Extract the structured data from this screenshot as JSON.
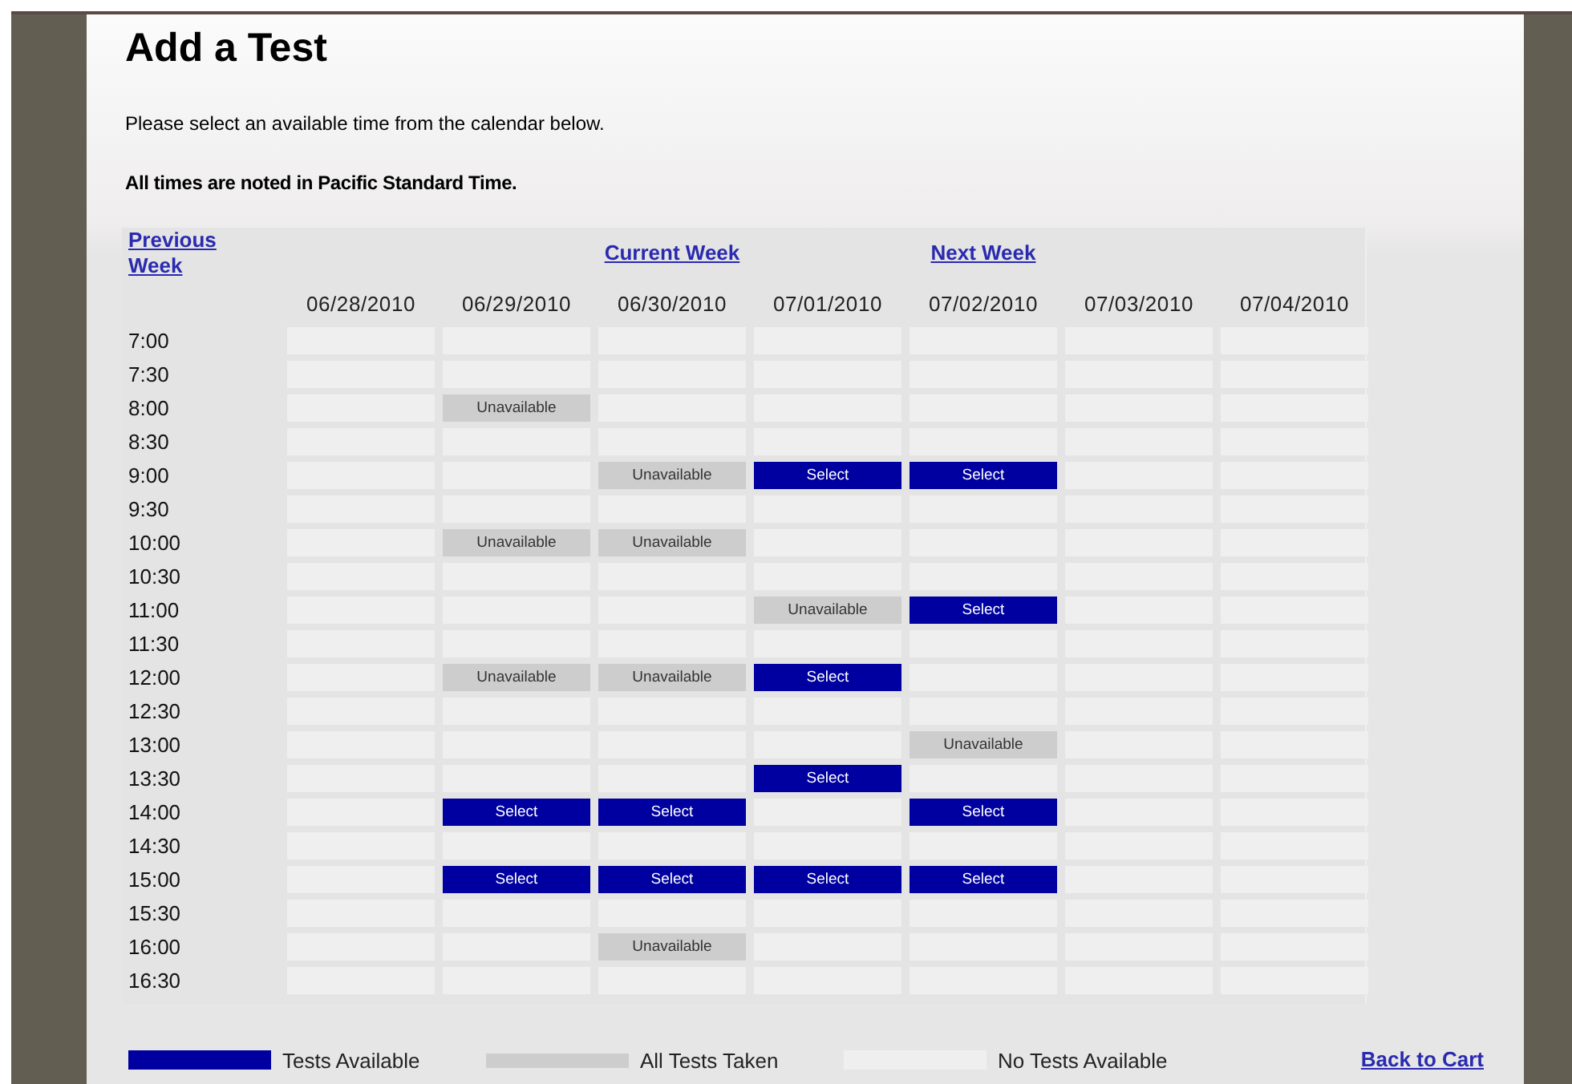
{
  "title": "Add a Test",
  "instructions": "Please select an available time from the calendar below.",
  "timezone_note": "All times are noted in Pacific Standard Time.",
  "nav": {
    "previous": "Previous Week",
    "current": "Current Week",
    "next": "Next Week"
  },
  "dates": [
    "06/28/2010",
    "06/29/2010",
    "06/30/2010",
    "07/01/2010",
    "07/02/2010",
    "07/03/2010",
    "07/04/2010"
  ],
  "rows": [
    {
      "time": "7:00",
      "cells": [
        {
          "kind": "empty"
        },
        {
          "kind": "empty"
        },
        {
          "kind": "empty"
        },
        {
          "kind": "empty"
        },
        {
          "kind": "empty"
        },
        {
          "kind": "empty"
        },
        {
          "kind": "empty"
        }
      ]
    },
    {
      "time": "7:30",
      "cells": [
        {
          "kind": "empty"
        },
        {
          "kind": "empty"
        },
        {
          "kind": "empty"
        },
        {
          "kind": "empty"
        },
        {
          "kind": "empty"
        },
        {
          "kind": "empty"
        },
        {
          "kind": "empty"
        }
      ]
    },
    {
      "time": "8:00",
      "cells": [
        {
          "kind": "empty"
        },
        {
          "kind": "unavailable",
          "label": "Unavailable"
        },
        {
          "kind": "empty"
        },
        {
          "kind": "empty"
        },
        {
          "kind": "empty"
        },
        {
          "kind": "empty"
        },
        {
          "kind": "empty"
        }
      ]
    },
    {
      "time": "8:30",
      "cells": [
        {
          "kind": "empty"
        },
        {
          "kind": "empty"
        },
        {
          "kind": "empty"
        },
        {
          "kind": "empty"
        },
        {
          "kind": "empty"
        },
        {
          "kind": "empty"
        },
        {
          "kind": "empty"
        }
      ]
    },
    {
      "time": "9:00",
      "cells": [
        {
          "kind": "empty"
        },
        {
          "kind": "empty"
        },
        {
          "kind": "unavailable",
          "label": "Unavailable"
        },
        {
          "kind": "select",
          "label": "Select"
        },
        {
          "kind": "select",
          "label": "Select"
        },
        {
          "kind": "empty"
        },
        {
          "kind": "empty"
        }
      ]
    },
    {
      "time": "9:30",
      "cells": [
        {
          "kind": "empty"
        },
        {
          "kind": "empty"
        },
        {
          "kind": "empty"
        },
        {
          "kind": "empty"
        },
        {
          "kind": "empty"
        },
        {
          "kind": "empty"
        },
        {
          "kind": "empty"
        }
      ]
    },
    {
      "time": "10:00",
      "cells": [
        {
          "kind": "empty"
        },
        {
          "kind": "unavailable",
          "label": "Unavailable"
        },
        {
          "kind": "unavailable",
          "label": "Unavailable"
        },
        {
          "kind": "empty"
        },
        {
          "kind": "empty"
        },
        {
          "kind": "empty"
        },
        {
          "kind": "empty"
        }
      ]
    },
    {
      "time": "10:30",
      "cells": [
        {
          "kind": "empty"
        },
        {
          "kind": "empty"
        },
        {
          "kind": "empty"
        },
        {
          "kind": "empty"
        },
        {
          "kind": "empty"
        },
        {
          "kind": "empty"
        },
        {
          "kind": "empty"
        }
      ]
    },
    {
      "time": "11:00",
      "cells": [
        {
          "kind": "empty"
        },
        {
          "kind": "empty"
        },
        {
          "kind": "empty"
        },
        {
          "kind": "unavailable",
          "label": "Unavailable"
        },
        {
          "kind": "select",
          "label": "Select"
        },
        {
          "kind": "empty"
        },
        {
          "kind": "empty"
        }
      ]
    },
    {
      "time": "11:30",
      "cells": [
        {
          "kind": "empty"
        },
        {
          "kind": "empty"
        },
        {
          "kind": "empty"
        },
        {
          "kind": "empty"
        },
        {
          "kind": "empty"
        },
        {
          "kind": "empty"
        },
        {
          "kind": "empty"
        }
      ]
    },
    {
      "time": "12:00",
      "cells": [
        {
          "kind": "empty"
        },
        {
          "kind": "unavailable",
          "label": "Unavailable"
        },
        {
          "kind": "unavailable",
          "label": "Unavailable"
        },
        {
          "kind": "select",
          "label": "Select"
        },
        {
          "kind": "empty"
        },
        {
          "kind": "empty"
        },
        {
          "kind": "empty"
        }
      ]
    },
    {
      "time": "12:30",
      "cells": [
        {
          "kind": "empty"
        },
        {
          "kind": "empty"
        },
        {
          "kind": "empty"
        },
        {
          "kind": "empty"
        },
        {
          "kind": "empty"
        },
        {
          "kind": "empty"
        },
        {
          "kind": "empty"
        }
      ]
    },
    {
      "time": "13:00",
      "cells": [
        {
          "kind": "empty"
        },
        {
          "kind": "empty"
        },
        {
          "kind": "empty"
        },
        {
          "kind": "empty"
        },
        {
          "kind": "unavailable",
          "label": "Unavailable"
        },
        {
          "kind": "empty"
        },
        {
          "kind": "empty"
        }
      ]
    },
    {
      "time": "13:30",
      "cells": [
        {
          "kind": "empty"
        },
        {
          "kind": "empty"
        },
        {
          "kind": "empty"
        },
        {
          "kind": "select",
          "label": "Select"
        },
        {
          "kind": "empty"
        },
        {
          "kind": "empty"
        },
        {
          "kind": "empty"
        }
      ]
    },
    {
      "time": "14:00",
      "cells": [
        {
          "kind": "empty"
        },
        {
          "kind": "select",
          "label": "Select"
        },
        {
          "kind": "select",
          "label": "Select"
        },
        {
          "kind": "empty"
        },
        {
          "kind": "select",
          "label": "Select"
        },
        {
          "kind": "empty"
        },
        {
          "kind": "empty"
        }
      ]
    },
    {
      "time": "14:30",
      "cells": [
        {
          "kind": "empty"
        },
        {
          "kind": "empty"
        },
        {
          "kind": "empty"
        },
        {
          "kind": "empty"
        },
        {
          "kind": "empty"
        },
        {
          "kind": "empty"
        },
        {
          "kind": "empty"
        }
      ]
    },
    {
      "time": "15:00",
      "cells": [
        {
          "kind": "empty"
        },
        {
          "kind": "select",
          "label": "Select"
        },
        {
          "kind": "select",
          "label": "Select"
        },
        {
          "kind": "select",
          "label": "Select"
        },
        {
          "kind": "select",
          "label": "Select"
        },
        {
          "kind": "empty"
        },
        {
          "kind": "empty"
        }
      ]
    },
    {
      "time": "15:30",
      "cells": [
        {
          "kind": "empty"
        },
        {
          "kind": "empty"
        },
        {
          "kind": "empty"
        },
        {
          "kind": "empty"
        },
        {
          "kind": "empty"
        },
        {
          "kind": "empty"
        },
        {
          "kind": "empty"
        }
      ]
    },
    {
      "time": "16:00",
      "cells": [
        {
          "kind": "empty"
        },
        {
          "kind": "empty"
        },
        {
          "kind": "unavailable",
          "label": "Unavailable"
        },
        {
          "kind": "empty"
        },
        {
          "kind": "empty"
        },
        {
          "kind": "empty"
        },
        {
          "kind": "empty"
        }
      ]
    },
    {
      "time": "16:30",
      "cells": [
        {
          "kind": "empty"
        },
        {
          "kind": "empty"
        },
        {
          "kind": "empty"
        },
        {
          "kind": "empty"
        },
        {
          "kind": "empty"
        },
        {
          "kind": "empty"
        },
        {
          "kind": "empty"
        }
      ]
    }
  ],
  "legend": [
    {
      "kind": "select",
      "label": "Tests Available"
    },
    {
      "kind": "unavailable",
      "label": "All Tests Taken"
    },
    {
      "kind": "empty",
      "label": "No Tests Available"
    }
  ],
  "back_link": "Back to Cart"
}
